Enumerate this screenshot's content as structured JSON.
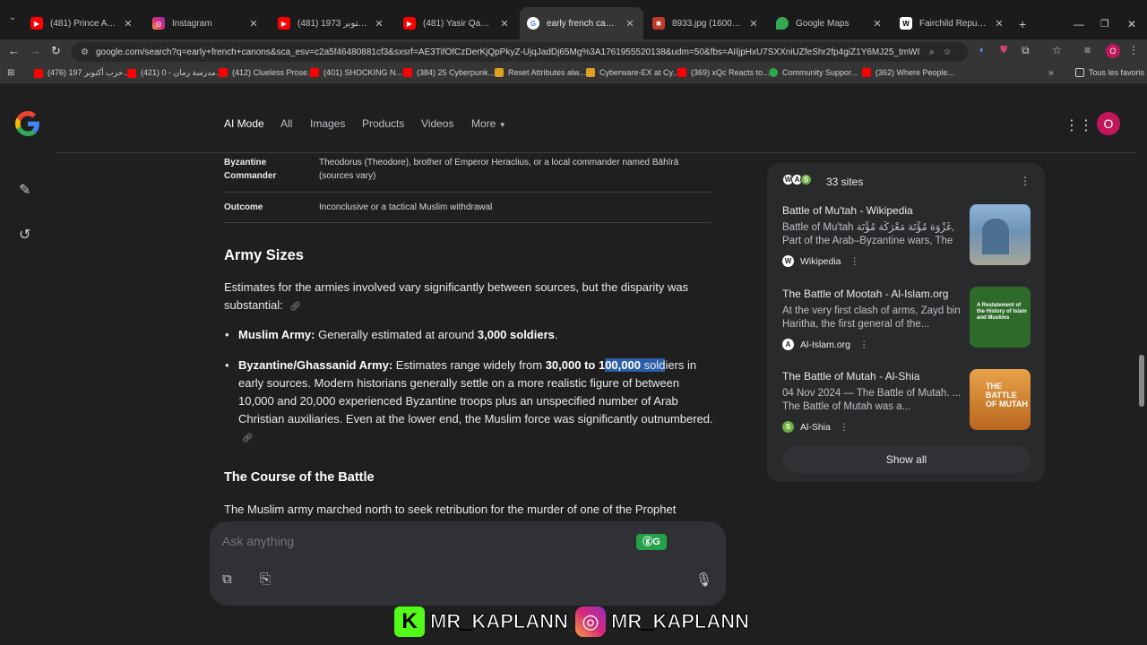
{
  "tabs": [
    {
      "title": "(481) Prince Andrew & th",
      "icon": "youtube-icon"
    },
    {
      "title": "Instagram",
      "icon": "instagram-icon"
    },
    {
      "title": "(481) حرب أكتوبر 1973 ...",
      "icon": "youtube-icon"
    },
    {
      "title": "(481) Yasir Qadhi - YouTub",
      "icon": "youtube-icon"
    },
    {
      "title": "early french canons - Goo",
      "icon": "google-icon"
    },
    {
      "title": "8933.jpg (1600×1067)",
      "icon": "image-icon"
    },
    {
      "title": "Google Maps",
      "icon": "maps-icon"
    },
    {
      "title": "Fairchild Republic A-10 Th",
      "icon": "wikipedia-icon"
    }
  ],
  "address": "google.com/search?q=early+french+canons&sca_esv=c2a5f46480881cf3&sxsrf=AE3TifOfCzDerKjQpPkyZ-UjqJadDj65Mg%3A1761955520138&udm=50&fbs=AIIjpHxU7SXXniUZfeShr2fp4giZ1Y6MJ25_tmWITc7uy4KIegmOm...",
  "avatar_letter": "O",
  "bookmarks": [
    {
      "label": "(476) حرب أكتوبر 197..."
    },
    {
      "label": "(421) مدرسة زمان - 0..."
    },
    {
      "label": "(412) Clueless Prose..."
    },
    {
      "label": "(401) SHOCKING N..."
    },
    {
      "label": "(384) 25 Cyberpunk..."
    },
    {
      "label": "Reset Attributes alw..."
    },
    {
      "label": "Cyberware-EX at Cy..."
    },
    {
      "label": "(369) xQc Reacts to..."
    },
    {
      "label": "Community Suppor..."
    },
    {
      "label": "(362) Where People..."
    }
  ],
  "all_bookmarks": "Tous les favoris",
  "search_tabs": [
    "AI Mode",
    "All",
    "Images",
    "Products",
    "Videos",
    "More"
  ],
  "table": [
    {
      "label": "Byzantine Commander",
      "value": "Theodorus (Theodore), brother of Emperor Heraclius, or a local commander named Bāhīrā (sources vary)"
    },
    {
      "label": "Outcome",
      "value": "Inconclusive or a tactical Muslim withdrawal"
    }
  ],
  "section1": {
    "heading": "Army Sizes",
    "intro": "Estimates for the armies involved vary significantly between sources, but the disparity was substantial:",
    "bullet1": {
      "bold": "Muslim Army:",
      "text1": " Generally estimated at around ",
      "bold2": "3,000 soldiers",
      "text2": "."
    },
    "bullet2": {
      "bold": "Byzantine/Ghassanid Army:",
      "text1": " Estimates range widely from ",
      "bold2": "30,000 to 1",
      "highlight": "00,000",
      "hl_tail": " sold",
      "text2": "iers in early sources. Modern historians generally settle on a more realistic figure of between 10,000 and 20,000 experienced Byzantine troops plus an unspecified number of Arab Christian auxiliaries. Even at the lower end, the Muslim force was significantly outnumbered."
    }
  },
  "section2": {
    "heading": "The Course of the Battle",
    "text": "The Muslim army marched north to seek retribution for the murder of one of the Prophet"
  },
  "sources": {
    "count": "33 sites",
    "items": [
      {
        "title": "Battle of Mu'tah - Wikipedia",
        "snippet": "Battle of Mu'tah غَزْوَة مُؤْتَة مَعْرَكَة مُؤْتَة, Part of the Arab–Byzantine wars, The to...",
        "source": "Wikipedia",
        "src_icon": "W",
        "thumb_color": "#7a9bb8"
      },
      {
        "title": "The Battle of Mootah - Al-Islam.org",
        "snippet": "At the very first clash of arms, Zayd bin Haritha, the first general of the...",
        "source": "Al-Islam.org",
        "src_icon": "A",
        "thumb_color": "#2e6b2a",
        "thumb_text": "A Restatement of the History of Islam and Muslims"
      },
      {
        "title": "The Battle of Mutah - Al-Shia",
        "snippet": "04 Nov 2024 — The Battle of Mutah. ... The Battle of Mutah was a...",
        "source": "Al-Shia",
        "src_icon": "S",
        "thumb_color": "#c87a2a",
        "thumb_text": "THE BATTLE OF MUTAH"
      }
    ],
    "show_all": "Show all"
  },
  "ask": {
    "placeholder": "Ask anything"
  },
  "watermark": {
    "left": "MR_KAPLANN",
    "right": "MR_KAPLANN"
  }
}
